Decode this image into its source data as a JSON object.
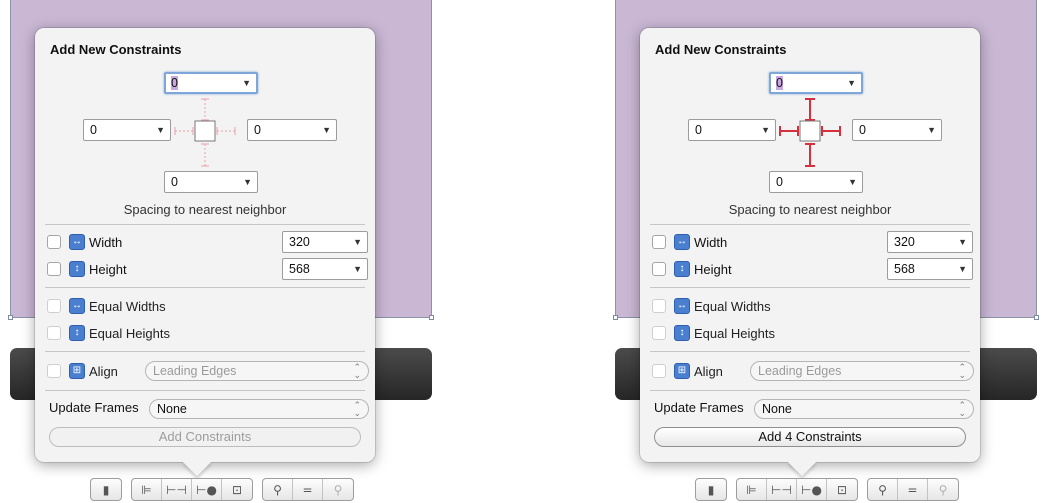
{
  "panels": [
    {
      "title": "Add New Constraints",
      "spacing": {
        "top": "0",
        "left": "0",
        "right": "0",
        "bottom": "0"
      },
      "caption": "Spacing to nearest neighbor",
      "width": {
        "label": "Width",
        "value": "320"
      },
      "height": {
        "label": "Height",
        "value": "568"
      },
      "equal_widths": "Equal Widths",
      "equal_heights": "Equal Heights",
      "align": {
        "label": "Align",
        "value": "Leading Edges"
      },
      "update_frames": {
        "label": "Update Frames",
        "value": "None"
      },
      "add_button": "Add Constraints",
      "strut_color": "#e9a0ab"
    },
    {
      "title": "Add New Constraints",
      "spacing": {
        "top": "0",
        "left": "0",
        "right": "0",
        "bottom": "0"
      },
      "caption": "Spacing to nearest neighbor",
      "width": {
        "label": "Width",
        "value": "320"
      },
      "height": {
        "label": "Height",
        "value": "568"
      },
      "equal_widths": "Equal Widths",
      "equal_heights": "Equal Heights",
      "align": {
        "label": "Align",
        "value": "Leading Edges"
      },
      "update_frames": {
        "label": "Update Frames",
        "value": "None"
      },
      "add_button": "Add 4 Constraints",
      "strut_color": "#d6303e"
    }
  ],
  "toolbar_icons": [
    "device-icon",
    "align-icon",
    "pin-icon",
    "resolve-icon",
    "resize-icon",
    "zoom-out-icon",
    "zoom-reset-icon",
    "zoom-in-icon"
  ],
  "colors": {
    "accent": "#4a7fd0",
    "focus_ring": "#7ea6d8",
    "view_bg": "#c9b7d4"
  }
}
